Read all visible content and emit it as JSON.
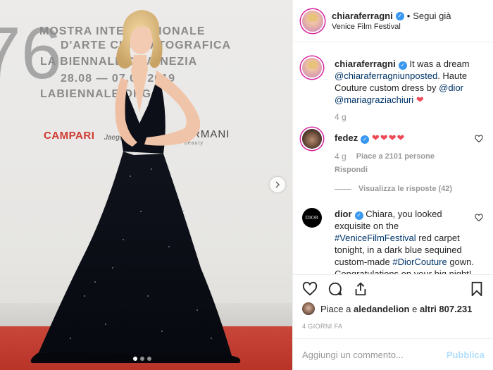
{
  "photo": {
    "wall_lines": [
      "MOSTRA INTERNAZIONALE",
      "D'ARTE CINEMATOGRAFICA",
      "LA BIENNALE DI VENEZIA",
      "28.08 — 07.09 2019",
      "LABIENNALE.ORG"
    ],
    "big_number": "76",
    "sponsors": [
      "CAMPARI",
      "Jaeger",
      "ARMANI",
      "beauty"
    ],
    "carousel_count": 3,
    "carousel_active": 1
  },
  "header": {
    "username": "chiaraferragni",
    "follow_label": "Segui già",
    "separator": "•",
    "location": "Venice Film Festival"
  },
  "caption": {
    "username": "chiaraferragni",
    "text_1": "It was a dream",
    "tag_1": "@chiaraferragniunposted",
    "text_2": ". Haute Couture custom dress by ",
    "tag_2": "@dior",
    "tag_3": "@mariagraziachiuri",
    "emoji": "❤",
    "time": "4 g"
  },
  "comments": [
    {
      "username": "fedez",
      "text": "❤❤❤❤",
      "time": "4 g",
      "likes": "Piace a 2101 persone",
      "reply": "Rispondi",
      "view_replies": "Visualizza le risposte (42)"
    },
    {
      "username": "dior",
      "avatar_label": "DIOR",
      "text_1": "Chiara, you looked exquisite on the ",
      "tag_1": "#VeniceFilmFestival",
      "text_2": " red carpet tonight, in a dark blue sequined custom-made ",
      "tag_2": "#DiorCouture",
      "text_3": " gown. Congratulations on your big night!"
    }
  ],
  "likes": {
    "prefix": "Piace a",
    "user": "aledandelion",
    "middle": "e",
    "others": "altri 807.231"
  },
  "timestamp": "4 GIORNI FA",
  "add_comment": {
    "placeholder": "Aggiungi un commento...",
    "post_label": "Pubblica"
  },
  "colors": {
    "link": "#003569",
    "heart": "#ed4956",
    "verified": "#3897f0",
    "muted": "#999999",
    "post_disabled": "#b2dffc"
  }
}
